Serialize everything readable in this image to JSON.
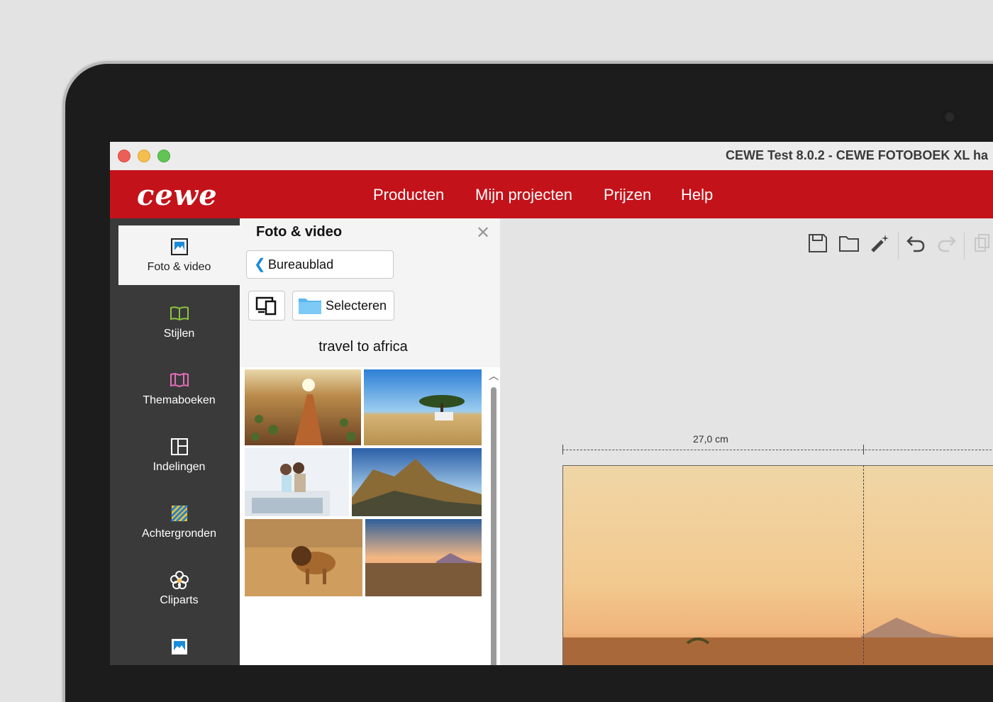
{
  "window": {
    "title": "CEWE Test 8.0.2 - CEWE FOTOBOEK XL ha"
  },
  "brand": {
    "logo": "cewe",
    "red": "#c4121a"
  },
  "nav": [
    "Producten",
    "Mijn projecten",
    "Prijzen",
    "Help"
  ],
  "sidebar": {
    "items": [
      {
        "label": "Foto & video",
        "icon": "photo-icon"
      },
      {
        "label": "Stijlen",
        "icon": "book-open-icon"
      },
      {
        "label": "Themaboeken",
        "icon": "theme-book-icon"
      },
      {
        "label": "Indelingen",
        "icon": "layout-icon"
      },
      {
        "label": "Achtergronden",
        "icon": "background-icon"
      },
      {
        "label": "Cliparts",
        "icon": "flower-icon"
      },
      {
        "label": "",
        "icon": "photo-icon"
      }
    ]
  },
  "panel": {
    "title": "Foto & video",
    "back_label": "Bureaublad",
    "select_label": "Selecteren",
    "folder_name": "travel to africa"
  },
  "gallery": {
    "images": [
      "desert-road-sunrise",
      "acacia-tree-with-car",
      "couple-on-van-roof",
      "coastal-mountains-sunset",
      "lion-walking",
      "desert-mountain-dusk"
    ]
  },
  "canvas": {
    "measure_label": "27,0 cm"
  }
}
